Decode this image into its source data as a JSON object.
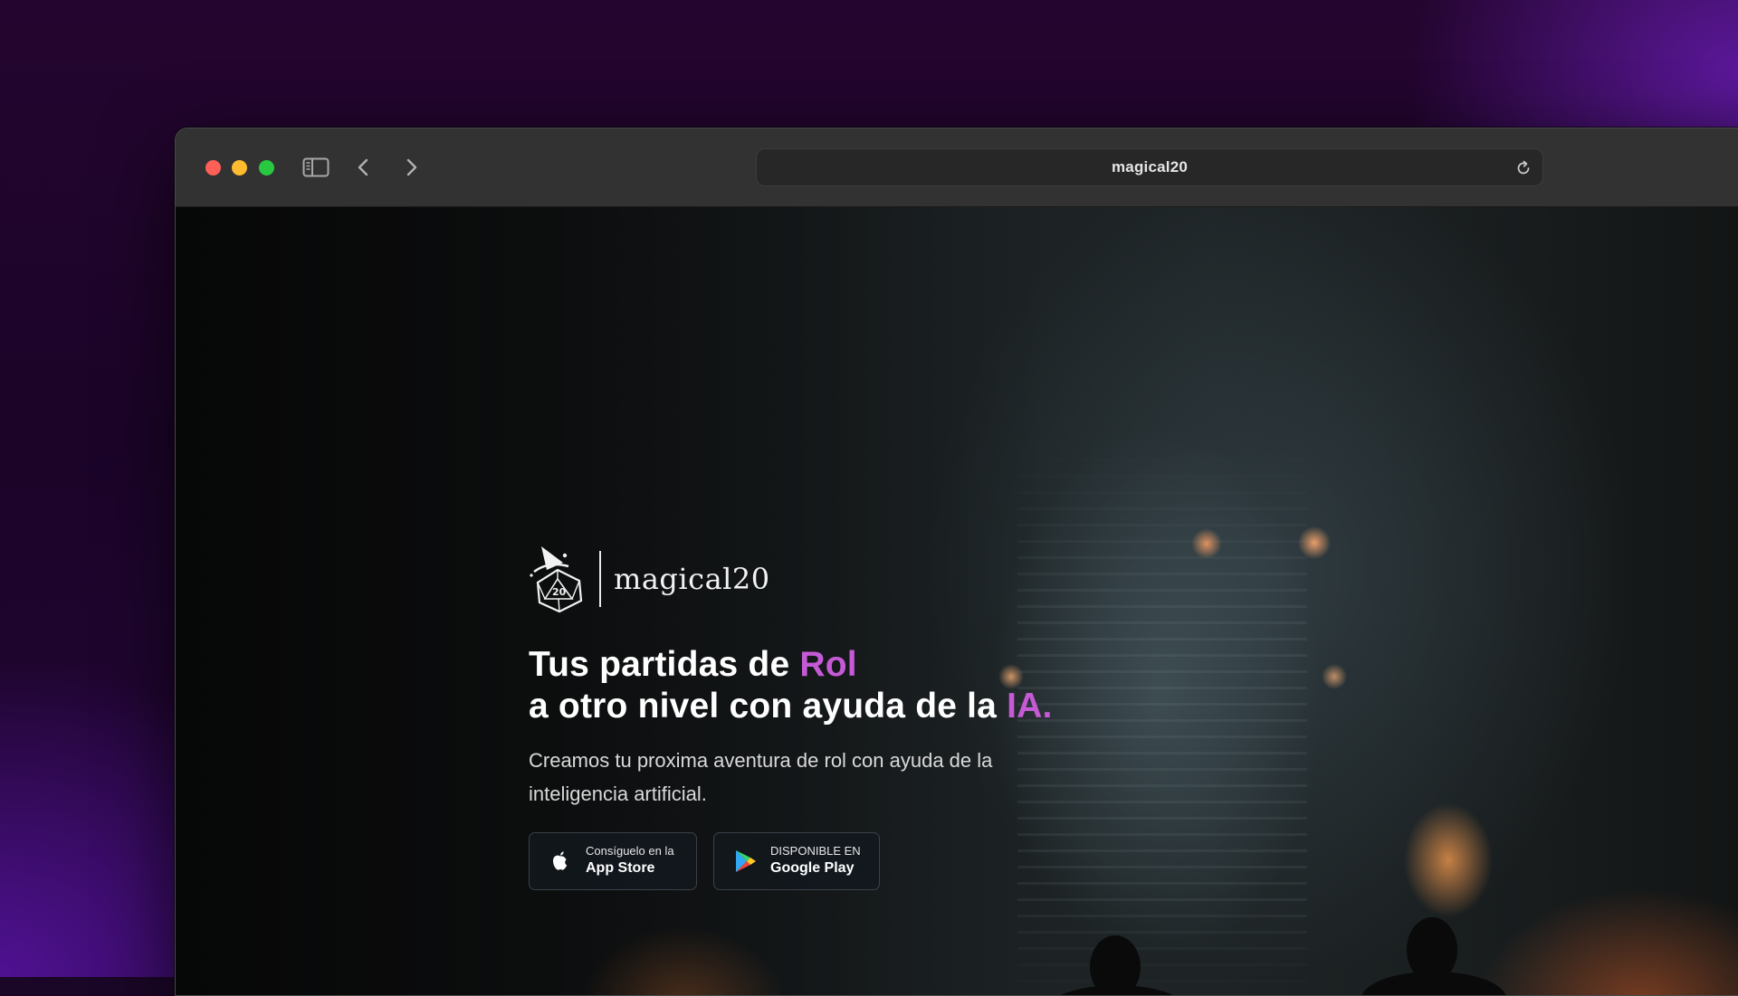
{
  "browser": {
    "address": "magical20"
  },
  "hero": {
    "logo_text": "magical20",
    "headline_line1_prefix": "Tus partidas de ",
    "headline_line1_accent": "Rol",
    "headline_line2_prefix": "a otro nivel con ayuda de la ",
    "headline_line2_accent": "IA.",
    "subtitle": "Creamos tu proxima aventura de rol con ayuda de la inteligencia artificial."
  },
  "stores": {
    "apple": {
      "small": "Consíguelo en la",
      "big": "App Store",
      "icon": "apple-icon"
    },
    "google": {
      "small": "DISPONIBLE EN",
      "big": "Google Play",
      "icon": "google-play-icon"
    }
  },
  "colors": {
    "accent": "#c45ad6",
    "toolbar": "#323233",
    "traffic_red": "#fe5f57",
    "traffic_yellow": "#febc2e",
    "traffic_green": "#28c840"
  }
}
